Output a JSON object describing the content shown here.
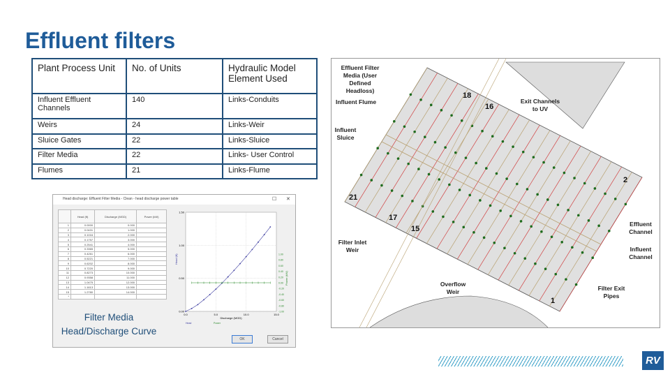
{
  "title": "Effluent filters",
  "table": {
    "headers": [
      "Plant Process Unit",
      "No. of Units",
      "Hydraulic Model Element Used"
    ],
    "rows": [
      [
        "Influent Effluent Channels",
        "140",
        "Links-Conduits"
      ],
      [
        "Weirs",
        "24",
        "Links-Weir"
      ],
      [
        "Sluice Gates",
        "22",
        "Links-Sluice"
      ],
      [
        "Filter Media",
        "22",
        "Links- User Control"
      ],
      [
        "Flumes",
        "21",
        "Links-Flume"
      ]
    ]
  },
  "dialog": {
    "title": "Head discharge: Effluent Filter Media - Clean - head discharge power table",
    "columns": [
      "",
      "Head (ft)",
      "Discharge (MGD)",
      "Power (kW)"
    ],
    "rows": [
      [
        "1",
        "0.0000",
        "0.000"
      ],
      [
        "2",
        "0.0431",
        "1.000"
      ],
      [
        "3",
        "0.1016",
        "2.000"
      ],
      [
        "4",
        "0.1757",
        "3.000"
      ],
      [
        "5",
        "0.2541",
        "4.000"
      ],
      [
        "6",
        "0.3365",
        "5.000"
      ],
      [
        "7",
        "0.4261",
        "6.000"
      ],
      [
        "8",
        "0.5221",
        "7.000"
      ],
      [
        "9",
        "0.6202",
        "8.000"
      ],
      [
        "10",
        "0.7220",
        "9.000"
      ],
      [
        "11",
        "0.8273",
        "10.000"
      ],
      [
        "12",
        "0.9358",
        "11.000"
      ],
      [
        "13",
        "1.0475",
        "12.000"
      ],
      [
        "14",
        "1.1613",
        "13.000"
      ],
      [
        "15",
        "1.2780",
        "14.000"
      ],
      [
        "*",
        "",
        ""
      ]
    ],
    "chart": {
      "y_ticks": [
        "1.50",
        "1.00",
        "0.50",
        "0.00"
      ],
      "x_ticks": [
        "0.0",
        "5.0",
        "10.0",
        "15.0"
      ],
      "xlabel": "Discharge (MGD)",
      "ylabel": "Head (ft)",
      "y2label": "Power (kW)",
      "y2_ticks": [
        "1.00",
        "0.80",
        "0.60",
        "0.40",
        "0.20",
        "0.00",
        "-0.20",
        "-0.40",
        "-0.60",
        "-0.80",
        "-1.00"
      ],
      "legend": [
        "Head",
        "Power"
      ],
      "colors": {
        "head": "#3c3ca0",
        "power": "#2e8b2e"
      }
    },
    "caption_line1": "Filter Media",
    "caption_line2": "Head/Discharge Curve",
    "ok": "OK",
    "cancel": "Cancel"
  },
  "map": {
    "labels": [
      "Effluent Filter Media (User Defined Headloss)",
      "Influent Flume",
      "Influent Sluice",
      "Exit Channels to UV",
      "Filter Inlet Weir",
      "Overflow Weir",
      "Effluent Channel",
      "Influent Channel",
      "Filter Exit Pipes"
    ],
    "numbers": [
      "18",
      "16",
      "2",
      "21",
      "17",
      "15",
      "1"
    ]
  },
  "logo": "RV"
}
